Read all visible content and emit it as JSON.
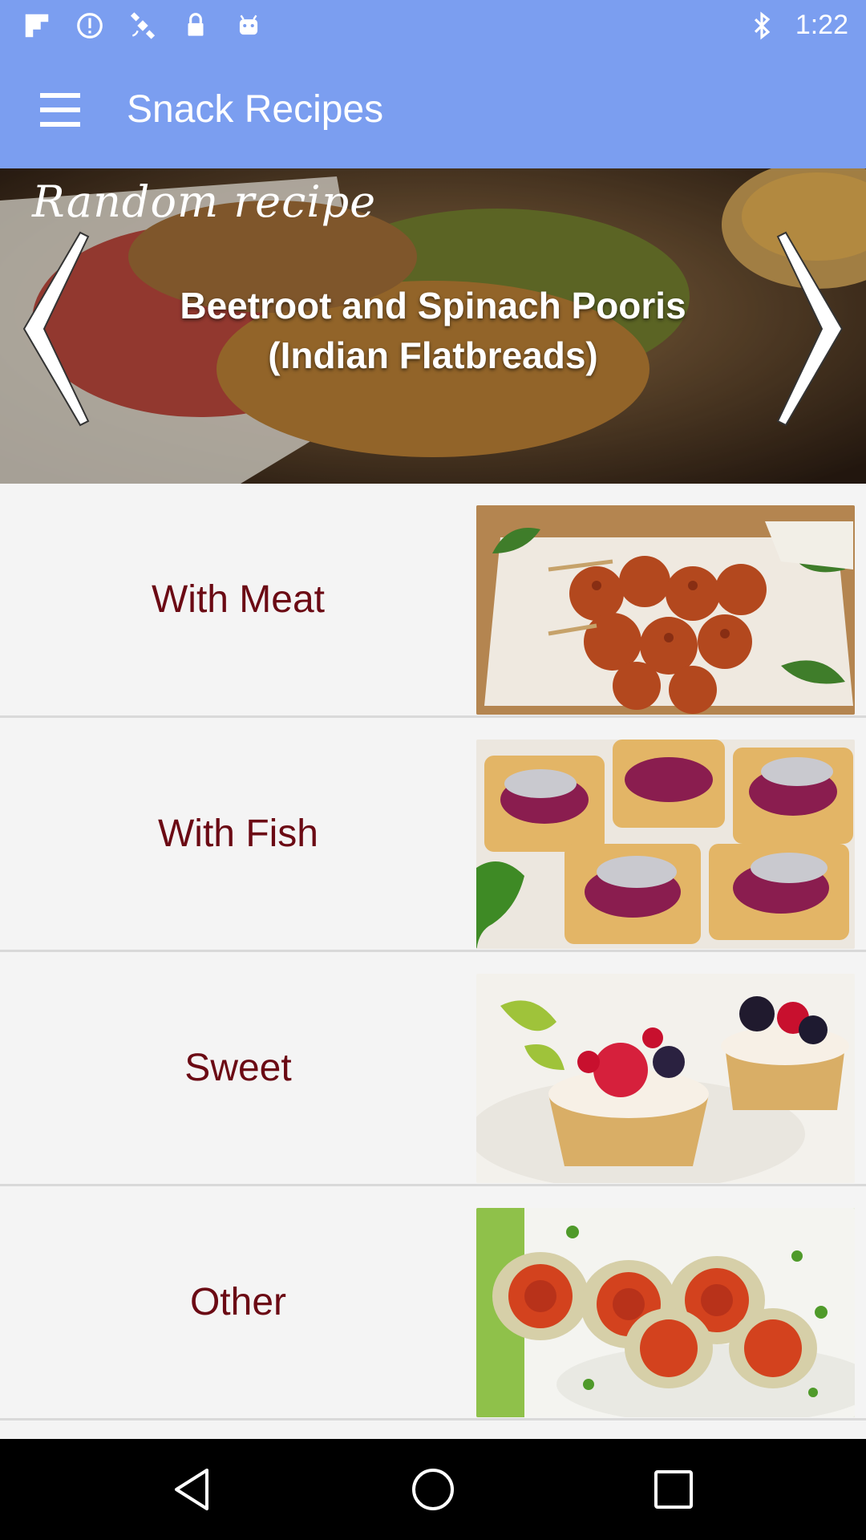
{
  "status_bar": {
    "time": "1:22",
    "icons": [
      "flipboard-icon",
      "info-icon",
      "fake-gps-icon",
      "lock-icon",
      "android-icon",
      "bluetooth-icon"
    ]
  },
  "app_bar": {
    "title": "Snack Recipes",
    "menu_icon": "hamburger-menu-icon"
  },
  "hero": {
    "tag": "Random recipe",
    "title": "Beetroot and Spinach Pooris (Indian Flatbreads)"
  },
  "categories": [
    {
      "label": "With Meat",
      "image": "meatball-skewers-photo"
    },
    {
      "label": "With Fish",
      "image": "herring-tarts-photo"
    },
    {
      "label": "Sweet",
      "image": "berry-tartlets-photo"
    },
    {
      "label": "Other",
      "image": "eggplant-rolls-photo"
    }
  ],
  "colors": {
    "app_bar": "#7b9ef0",
    "category_text": "#6b0a14",
    "list_bg": "#f4f4f4",
    "nav_bar": "#000000"
  }
}
